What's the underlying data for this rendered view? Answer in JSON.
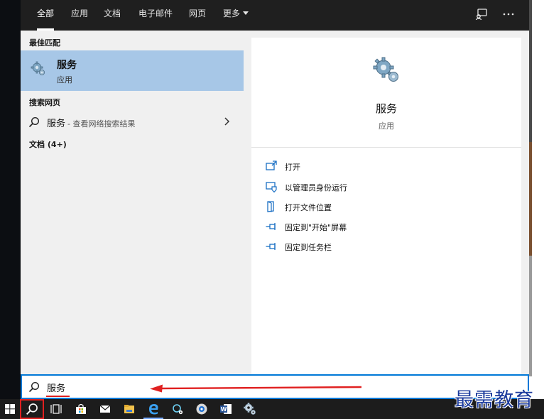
{
  "tabs": [
    {
      "label": "全部"
    },
    {
      "label": "应用"
    },
    {
      "label": "文档"
    },
    {
      "label": "电子邮件"
    },
    {
      "label": "网页"
    },
    {
      "label": "更多"
    }
  ],
  "toolbar_icons": [
    "feedback-icon",
    "more-options-icon"
  ],
  "left": {
    "best_match_header": "最佳匹配",
    "best_match": {
      "title": "服务",
      "subtitle": "应用",
      "icon": "gears-icon"
    },
    "web_header": "搜索网页",
    "web_result": {
      "term": "服务",
      "hint": "- 查看网络搜索结果"
    },
    "docs_header": "文档 (4+)"
  },
  "right": {
    "app_name": "服务",
    "app_type": "应用",
    "actions": [
      {
        "label": "打开",
        "icon": "open-icon"
      },
      {
        "label": "以管理员身份运行",
        "icon": "run-as-admin-icon"
      },
      {
        "label": "打开文件位置",
        "icon": "file-location-icon"
      },
      {
        "label": "固定到\"开始\"屏幕",
        "icon": "pin-icon"
      },
      {
        "label": "固定到任务栏",
        "icon": "pin-icon"
      }
    ]
  },
  "search": {
    "value": "服务"
  },
  "taskbar": [
    "windows-start-icon",
    "search-icon",
    "task-view-icon",
    "store-icon",
    "mail-icon",
    "file-explorer-icon",
    "edge-icon",
    "settings-search-icon",
    "app-icon",
    "word-icon",
    "services-icon"
  ],
  "watermark": "最需教育",
  "colors": {
    "accent": "#0078d7",
    "selection": "#a7c7e7",
    "annotation": "#e02020",
    "watermark": "#1b3a9c"
  }
}
